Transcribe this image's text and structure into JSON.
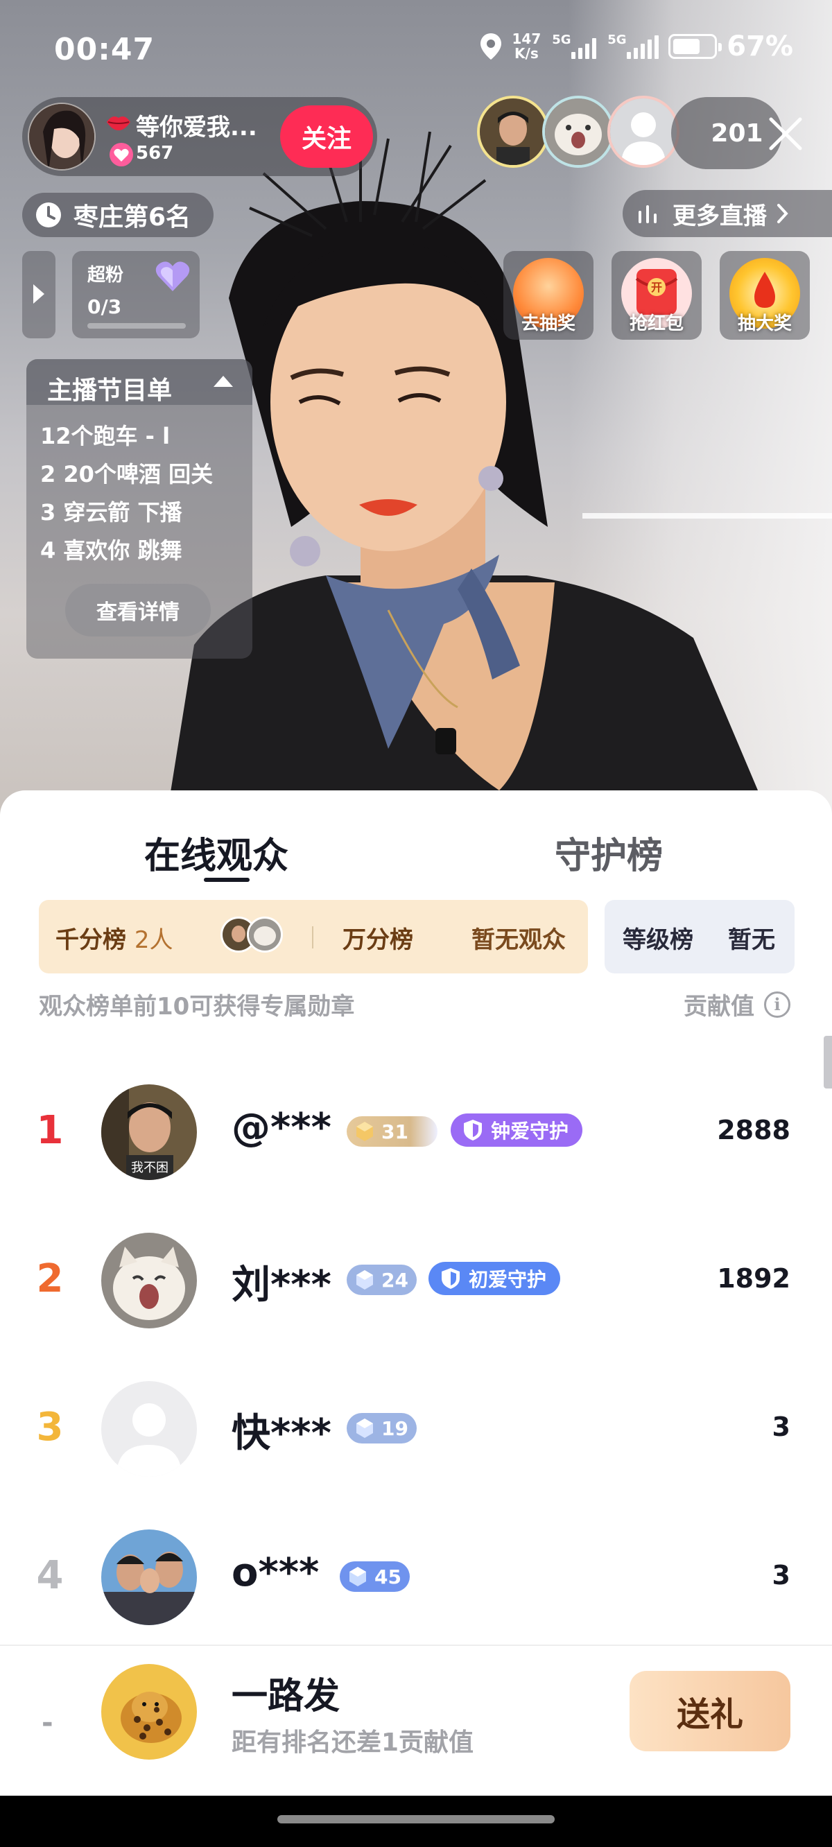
{
  "status_bar": {
    "time": "00:47",
    "net_speed_value": "147",
    "net_speed_unit": "K/s",
    "sim1": "5G",
    "sim2": "5G",
    "battery": "67%",
    "battery_level": 0.67
  },
  "host": {
    "name": "等你爱我...",
    "likes": "567",
    "follow_label": "关注"
  },
  "viewer_count": "201",
  "rank_label": "枣庄第6名",
  "more_live_label": "更多直播",
  "superfan": {
    "title": "超粉",
    "count": "0/3"
  },
  "activities": [
    {
      "label": "去抽奖",
      "icon": "goldfish-icon"
    },
    {
      "label": "抢红包",
      "icon": "red-envelope-icon"
    },
    {
      "label": "抽大奖",
      "icon": "big-prize-icon"
    }
  ],
  "program": {
    "title": "主播节目单",
    "items": [
      "12个跑车 - l",
      "2 20个啤酒 回关",
      "3 穿云箭 下播",
      "4 喜欢你 跳舞"
    ],
    "detail_label": "查看详情"
  },
  "sheet": {
    "tabs": [
      "在线观众",
      "守护榜"
    ],
    "board_a": {
      "label": "千分榜",
      "count": "2人",
      "label2": "万分榜",
      "value2": "暂无观众"
    },
    "board_b": {
      "label": "等级榜",
      "value": "暂无"
    },
    "hint": "观众榜单前10可获得专属勋章",
    "contrib_label": "贡献值",
    "rows": [
      {
        "rank": "1",
        "name": "@***",
        "level": "31",
        "guard": "钟爱守护",
        "score": "2888"
      },
      {
        "rank": "2",
        "name": "刘***",
        "level": "24",
        "guard": "初爱守护",
        "score": "1892"
      },
      {
        "rank": "3",
        "name": "快***",
        "level": "19",
        "guard": "",
        "score": "3"
      },
      {
        "rank": "4",
        "name": "o***",
        "level": "45",
        "guard": "",
        "score": "3"
      }
    ],
    "self": {
      "rank": "-",
      "name": "一路发",
      "sub": "距有排名还差1贡献值",
      "gift_label": "送礼"
    }
  },
  "colors": {
    "follow": "#fe2c55",
    "rank1": "#e8313a",
    "rank2": "#ef6a2f",
    "rank3": "#f3b63a",
    "rank4": "#b8b9bd",
    "guard_purple": "#9a6bf5",
    "guard_blue": "#5a88f5"
  }
}
